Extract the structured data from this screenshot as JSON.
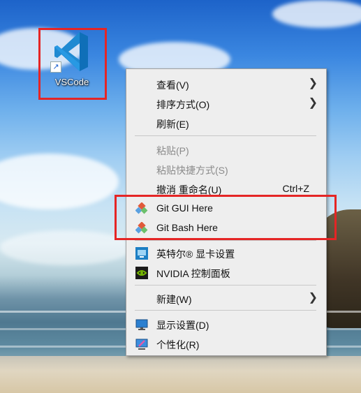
{
  "desktop": {
    "shortcut": {
      "label": "VSCode",
      "icon": "vscode-icon"
    }
  },
  "context_menu": {
    "view": {
      "label": "查看(V)"
    },
    "sort": {
      "label": "排序方式(O)"
    },
    "refresh": {
      "label": "刷新(E)"
    },
    "paste": {
      "label": "粘贴(P)"
    },
    "paste_shortcut": {
      "label": "粘贴快捷方式(S)"
    },
    "undo": {
      "label": "撤消 重命名(U)",
      "shortcut": "Ctrl+Z"
    },
    "git_gui": {
      "label": "Git GUI Here",
      "icon": "git-icon"
    },
    "git_bash": {
      "label": "Git Bash Here",
      "icon": "git-icon"
    },
    "intel": {
      "label": "英特尔® 显卡设置",
      "icon": "intel-graphics-icon"
    },
    "nvidia": {
      "label": "NVIDIA 控制面板",
      "icon": "nvidia-icon"
    },
    "new": {
      "label": "新建(W)"
    },
    "display": {
      "label": "显示设置(D)",
      "icon": "display-icon"
    },
    "personalize": {
      "label": "个性化(R)",
      "icon": "personalize-icon"
    }
  },
  "colors": {
    "highlight_box": "#e52525",
    "menu_bg": "#eeeeee",
    "vscode_blue": "#1f8ad2"
  }
}
